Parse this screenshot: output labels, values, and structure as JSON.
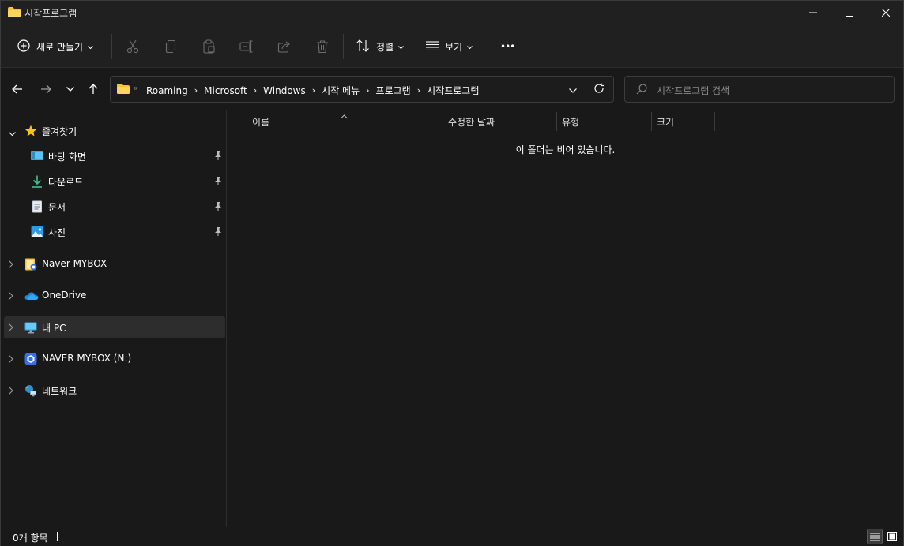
{
  "window": {
    "title": "시작프로그램"
  },
  "commandbar": {
    "new_label": "새로 만들기",
    "sort_label": "정렬",
    "view_label": "보기",
    "more_label": "•••"
  },
  "address": {
    "overflow_marker": "«",
    "crumbs": [
      "Roaming",
      "Microsoft",
      "Windows",
      "시작 메뉴",
      "프로그램",
      "시작프로그램"
    ]
  },
  "search": {
    "placeholder": "시작프로그램 검색"
  },
  "sidebar": {
    "quick_access": "즐겨찾기",
    "pinned": [
      {
        "label": "바탕 화면"
      },
      {
        "label": "다운로드"
      },
      {
        "label": "문서"
      },
      {
        "label": "사진"
      }
    ],
    "items": [
      {
        "label": "Naver MYBOX"
      },
      {
        "label": "OneDrive"
      },
      {
        "label": "내 PC"
      },
      {
        "label": "NAVER MYBOX (N:)"
      },
      {
        "label": "네트워크"
      }
    ]
  },
  "columns": {
    "name": "이름",
    "modified": "수정한 날짜",
    "type": "유형",
    "size": "크기"
  },
  "content": {
    "empty_message": "이 폴더는 비어 있습니다."
  },
  "status": {
    "item_count": "0개 항목"
  },
  "colors": {
    "background": "#191919",
    "bar_background": "#202020",
    "folder_yellow": "#f8c13a",
    "star_yellow": "#f5c51c",
    "selection": "#2d2d2d"
  }
}
